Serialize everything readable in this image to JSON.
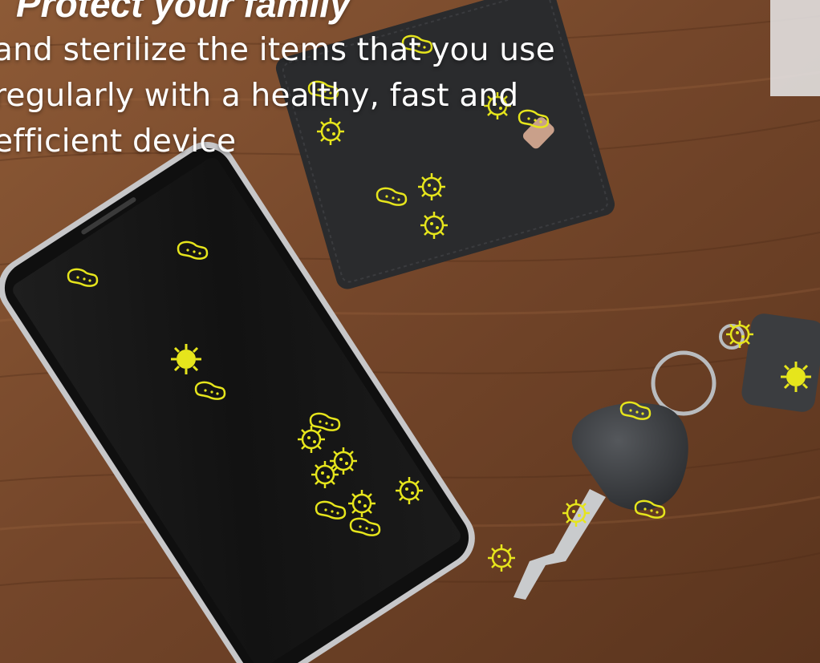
{
  "headline": "Protect your family",
  "description": {
    "lines": [
      "and sterilize the items that you use",
      "regularly with a healthy, fast and",
      "efficient device"
    ]
  },
  "colors": {
    "wood": "#7a4a2a",
    "germ": "#e6e51c",
    "phone_screen": "#141414",
    "wallet": "#2a2b2d",
    "key": "#3b3d40"
  },
  "icons": [
    "germ-icon",
    "virus-icon"
  ]
}
